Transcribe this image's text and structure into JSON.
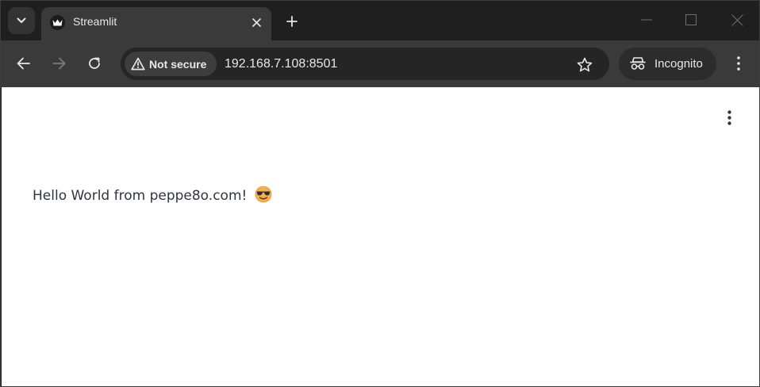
{
  "tab": {
    "title": "Streamlit",
    "favicon": "streamlit-crown-icon"
  },
  "address_bar": {
    "security_label": "Not secure",
    "url": "192.168.7.108:8501"
  },
  "profile": {
    "label": "Incognito"
  },
  "page": {
    "message": "Hello World from peppe8o.com!",
    "emoji": "smiling-face-with-sunglasses"
  },
  "colors": {
    "chrome_dark": "#1f1f1f",
    "toolbar": "#3a3a3a",
    "omnibox": "#252525",
    "page_bg": "#ffffff",
    "text": "#31333f"
  }
}
